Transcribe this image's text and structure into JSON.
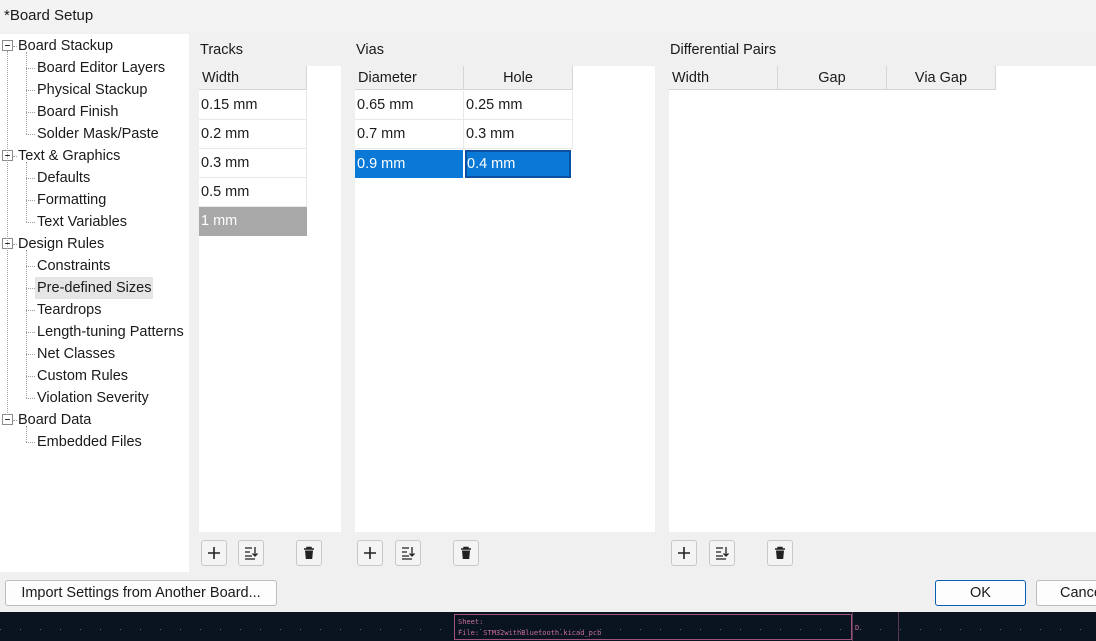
{
  "window": {
    "title": "*Board Setup"
  },
  "tree": [
    {
      "label": "Board Stackup",
      "level": 0,
      "expander": true
    },
    {
      "label": "Board Editor Layers",
      "level": 1
    },
    {
      "label": "Physical Stackup",
      "level": 1
    },
    {
      "label": "Board Finish",
      "level": 1
    },
    {
      "label": "Solder Mask/Paste",
      "level": 1
    },
    {
      "label": "Text & Graphics",
      "level": 0,
      "expander": true
    },
    {
      "label": "Defaults",
      "level": 1
    },
    {
      "label": "Formatting",
      "level": 1
    },
    {
      "label": "Text Variables",
      "level": 1
    },
    {
      "label": "Design Rules",
      "level": 0,
      "expander": true
    },
    {
      "label": "Constraints",
      "level": 1
    },
    {
      "label": "Pre-defined Sizes",
      "level": 1,
      "selected": true
    },
    {
      "label": "Teardrops",
      "level": 1
    },
    {
      "label": "Length-tuning Patterns",
      "level": 1
    },
    {
      "label": "Net Classes",
      "level": 1
    },
    {
      "label": "Custom Rules",
      "level": 1
    },
    {
      "label": "Violation Severity",
      "level": 1
    },
    {
      "label": "Board Data",
      "level": 0,
      "expander": true
    },
    {
      "label": "Embedded Files",
      "level": 1
    }
  ],
  "tracks": {
    "title": "Tracks",
    "columns": [
      "Width"
    ],
    "rows": [
      "0.15 mm",
      "0.2 mm",
      "0.3 mm",
      "0.5 mm",
      "1 mm"
    ],
    "selected_row": 4
  },
  "vias": {
    "title": "Vias",
    "columns": [
      "Diameter",
      "Hole"
    ],
    "rows": [
      [
        "0.65 mm",
        "0.25 mm"
      ],
      [
        "0.7 mm",
        "0.3 mm"
      ],
      [
        "0.9 mm",
        "0.4 mm"
      ]
    ],
    "selected_row": 2
  },
  "diff_pairs": {
    "title": "Differential Pairs",
    "columns": [
      "Width",
      "Gap",
      "Via Gap"
    ],
    "rows": []
  },
  "buttons": {
    "import": "Import Settings from Another Board...",
    "ok": "OK",
    "cancel": "Cance"
  },
  "canvas": {
    "sheet_label": "Sheet:",
    "file_label": "File: STM32withBluetooth.kicad_pcb",
    "corner_mark": "D"
  },
  "colors": {
    "selection_blue": "#0a78d7",
    "selection_gray": "#a8a8a8",
    "ok_border": "#0a5fb4"
  }
}
